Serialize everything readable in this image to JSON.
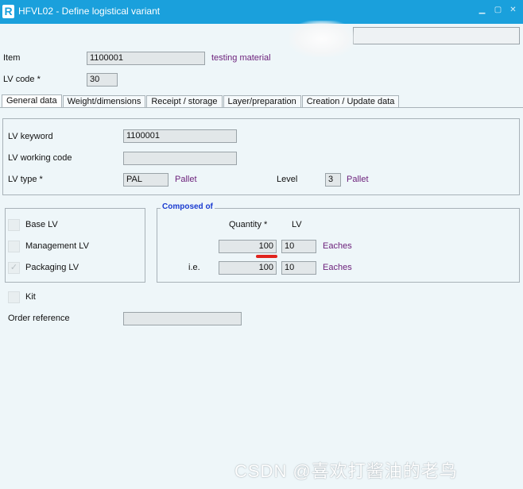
{
  "window": {
    "logo": "R",
    "title": "HFVL02 - Define logistical variant"
  },
  "header": {
    "item_label": "Item",
    "item_value": "1100001",
    "item_desc": "testing material",
    "lvcode_label": "LV code *",
    "lvcode_value": "30"
  },
  "tabs": [
    {
      "label": "General data"
    },
    {
      "label": "Weight/dimensions"
    },
    {
      "label": "Receipt / storage"
    },
    {
      "label": "Layer/preparation"
    },
    {
      "label": "Creation / Update data"
    }
  ],
  "general": {
    "keyword_label": "LV keyword",
    "keyword_value": "1100001",
    "working_label": "LV working code",
    "working_value": "",
    "type_label": "LV type *",
    "type_value": "PAL",
    "type_desc": "Pallet",
    "level_label": "Level",
    "level_value": "3",
    "level_desc": "Pallet"
  },
  "options": {
    "base_label": "Base LV",
    "management_label": "Management LV",
    "packaging_label": "Packaging LV",
    "packaging_check": "✓",
    "kit_label": "Kit",
    "order_label": "Order reference",
    "order_value": ""
  },
  "composed": {
    "legend": "Composed of",
    "qty_header": "Quantity *",
    "lv_header": "LV",
    "row1_qty": "100",
    "row1_lv": "10",
    "row1_desc": "Eaches",
    "ie_label": "i.e.",
    "row2_qty": "100",
    "row2_lv": "10",
    "row2_desc": "Eaches"
  },
  "watermark": "CSDN @喜欢打酱油的老鸟",
  "colors": {
    "titlebar": "#1aa0dc",
    "description_text": "#6b1f7a",
    "group_legend": "#1a3bd0",
    "annotation_underline": "#e0241e"
  },
  "icons": {
    "minimize": "minimize-icon",
    "maximize": "maximize-icon",
    "close": "close-icon"
  }
}
